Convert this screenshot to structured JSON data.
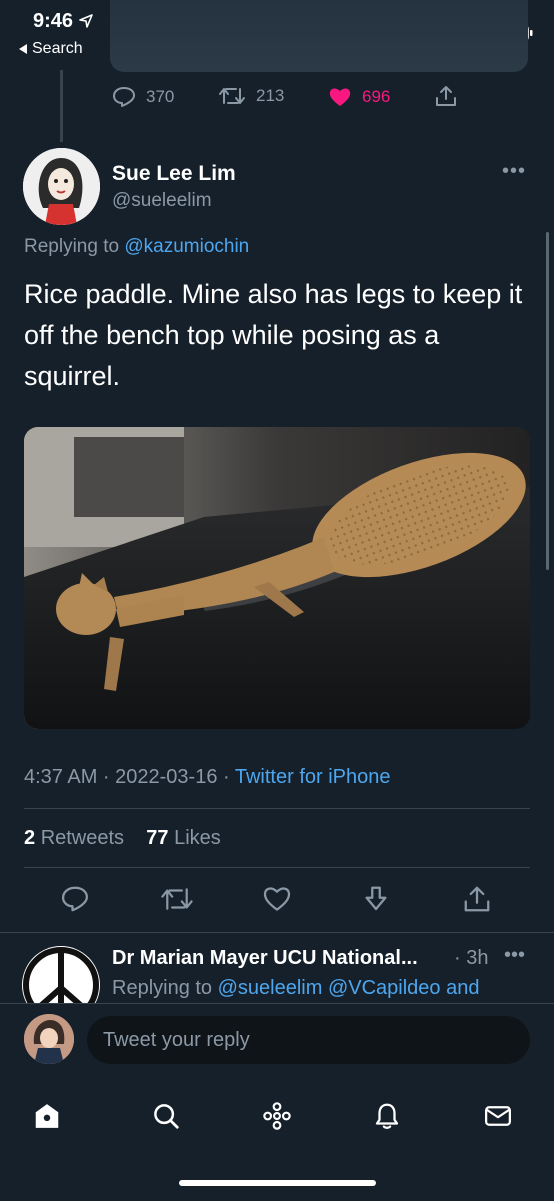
{
  "status_bar": {
    "time": "9:46",
    "back_label": "Search"
  },
  "previous_tweet": {
    "replies": "370",
    "retweets": "213",
    "likes": "696"
  },
  "tweet": {
    "display_name": "Sue Lee Lim",
    "handle": "@sueleelim",
    "replying_prefix": "Replying to",
    "replying_to": "@kazumiochin",
    "text": "Rice paddle. Mine also has legs to keep it off the bench top while posing as a squirrel.",
    "time": "4:37 AM · 2022-03-16 · ",
    "source": "Twitter for iPhone",
    "retweet_count": "2",
    "retweet_label": "Retweets",
    "like_count": "77",
    "like_label": "Likes"
  },
  "reply": {
    "display_name": "Dr Marian Mayer UCU National...",
    "time": "· 3h",
    "replying_prefix": "Replying to",
    "replying_to": "@sueleelim @VCapildeo and"
  },
  "composer": {
    "placeholder": "Tweet your reply"
  },
  "colors": {
    "background": "#15202b",
    "accent": "#4da6ee",
    "like": "#f91880",
    "muted": "#8b98a5"
  }
}
